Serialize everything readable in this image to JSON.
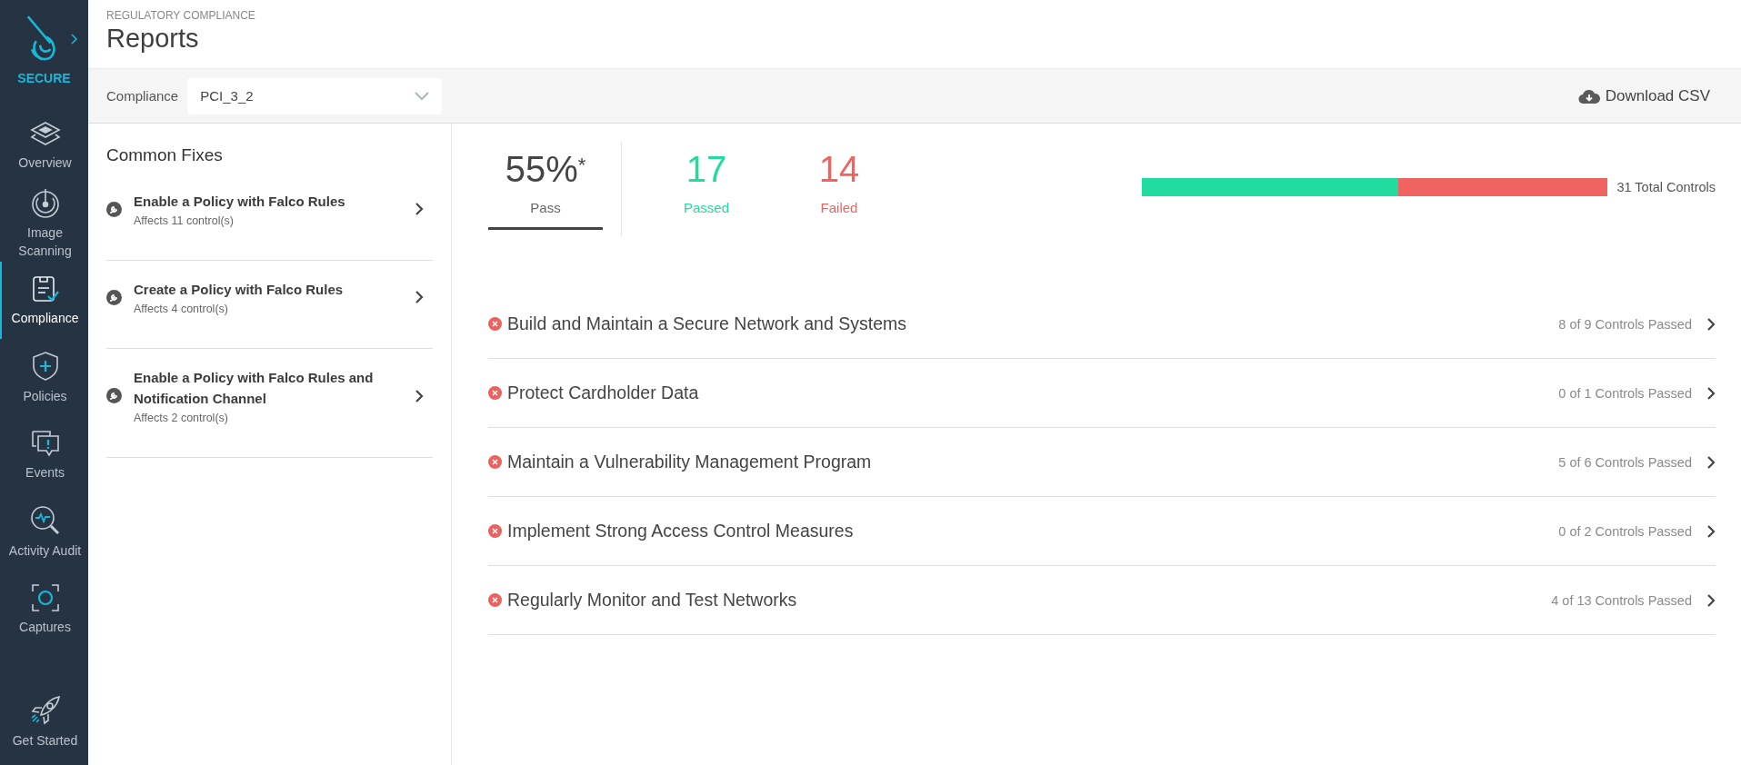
{
  "sidebar": {
    "brand": "SECURE",
    "items": [
      {
        "label": "Overview",
        "kind": "layers",
        "selected": false
      },
      {
        "label": "Image Scanning",
        "kind": "scan",
        "selected": false
      },
      {
        "label": "Compliance",
        "kind": "compliance",
        "selected": true
      },
      {
        "label": "Policies",
        "kind": "shield",
        "selected": false
      },
      {
        "label": "Events",
        "kind": "events",
        "selected": false
      },
      {
        "label": "Activity Audit",
        "kind": "audit",
        "selected": false
      },
      {
        "label": "Captures",
        "kind": "capture",
        "selected": false
      }
    ],
    "footer_item": {
      "label": "Get Started",
      "kind": "rocket",
      "selected": false
    }
  },
  "header": {
    "breadcrumb": "REGULATORY COMPLIANCE",
    "title": "Reports"
  },
  "toolbar": {
    "compliance_label": "Compliance",
    "compliance_value": "PCI_3_2",
    "download_label": "Download CSV"
  },
  "common_fixes": {
    "title": "Common Fixes",
    "items": [
      {
        "title": "Enable a Policy with Falco Rules",
        "affects": "Affects 11 control(s)"
      },
      {
        "title": "Create a Policy with Falco Rules",
        "affects": "Affects 4 control(s)"
      },
      {
        "title": "Enable a Policy with Falco Rules and Notification Channel",
        "affects": "Affects 2 control(s)"
      }
    ]
  },
  "summary": {
    "score": {
      "value": "55%",
      "mark": "*",
      "label": "Pass",
      "selected": true
    },
    "passed": {
      "count": "17",
      "label": "Passed"
    },
    "failed": {
      "count": "14",
      "label": "Failed"
    },
    "bar": {
      "level": 0.55
    },
    "total": "31 Total Controls"
  },
  "sections": [
    {
      "title": "Build and Maintain a Secure Network and Systems",
      "kind": "failed",
      "count": "8 of 9 Controls Passed"
    },
    {
      "title": "Protect Cardholder Data",
      "kind": "failed",
      "count": "0 of 1 Controls Passed"
    },
    {
      "title": "Maintain a Vulnerability Management Program",
      "kind": "failed",
      "count": "5 of 6 Controls Passed"
    },
    {
      "title": "Implement Strong Access Control Measures",
      "kind": "failed",
      "count": "0 of 2 Controls Passed"
    },
    {
      "title": "Regularly Monitor and Test Networks",
      "kind": "failed",
      "count": "4 of 13 Controls Passed"
    }
  ]
}
